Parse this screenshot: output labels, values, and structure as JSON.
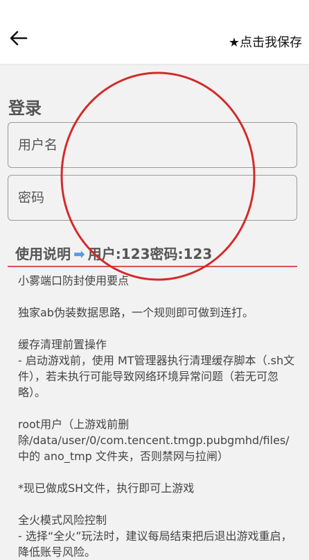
{
  "header": {
    "save_label": "★点击我保存"
  },
  "login": {
    "title": "登录",
    "username_placeholder": "用户名",
    "password_placeholder": "密码"
  },
  "usage": {
    "title": "使用说明",
    "arrow": "➡",
    "credentials": "用户:123密码:123"
  },
  "instructions": {
    "text": "小雾端口防封使用要点\n\n独家ab伪装数据思路，一个规则即可做到连打。\n\n缓存清理前置操作\n- 启动游戏前，使用 MT管理器执行清理缓存脚本（.sh文件），若未执行可能导致网络环境异常问题（若无可忽略）。\n\nroot用户（上游戏前删除/data/user/0/com.tencent.tmgp.pubgmhd/files/中的 ano_tmp 文件夹，否则禁网与拉闸）\n\n*现已做成SH文件，执行即可上游戏\n\n全火模式风险控制\n- 选择“全火”玩法时，建议每局结束把后退出游戏重启，降低账号风险。"
  },
  "colors": {
    "annotation_circle": "#d42a2a",
    "divider": "#d9534f",
    "arrow": "#5a9be0"
  }
}
